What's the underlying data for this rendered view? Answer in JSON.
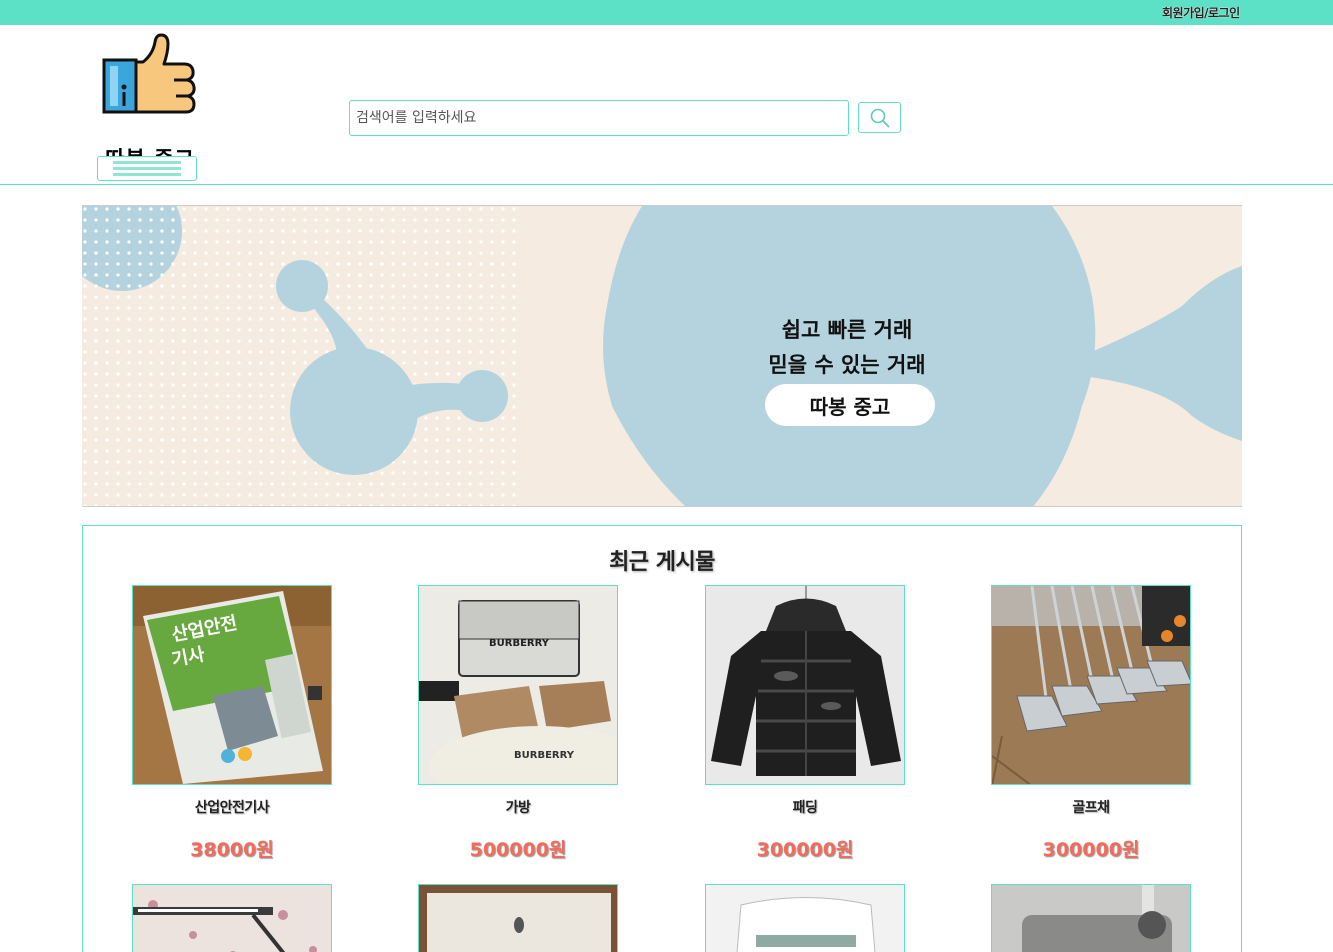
{
  "header": {
    "auth_link": "회원가입/로그인",
    "logo_text": "따봉 중고",
    "search_placeholder": "검색어를 입력하세요"
  },
  "banner": {
    "line1": "쉽고 빠른 거래",
    "line2": "믿을 수 있는 거래",
    "button": "따봉 중고"
  },
  "recent": {
    "title": "최근 게시물",
    "items": [
      {
        "title": "산업안전기사",
        "price": "38000원"
      },
      {
        "title": "가방",
        "price": "500000원"
      },
      {
        "title": "패딩",
        "price": "300000원"
      },
      {
        "title": "골프채",
        "price": "300000원"
      }
    ]
  },
  "colors": {
    "accent": "#5ce0c6",
    "price": "#f26b5b",
    "banner_bg": "#f6ebe1",
    "banner_blob": "#b5d3de"
  },
  "icons": [
    "thumbs-up-logo-icon",
    "hamburger-menu-icon",
    "search-icon"
  ]
}
